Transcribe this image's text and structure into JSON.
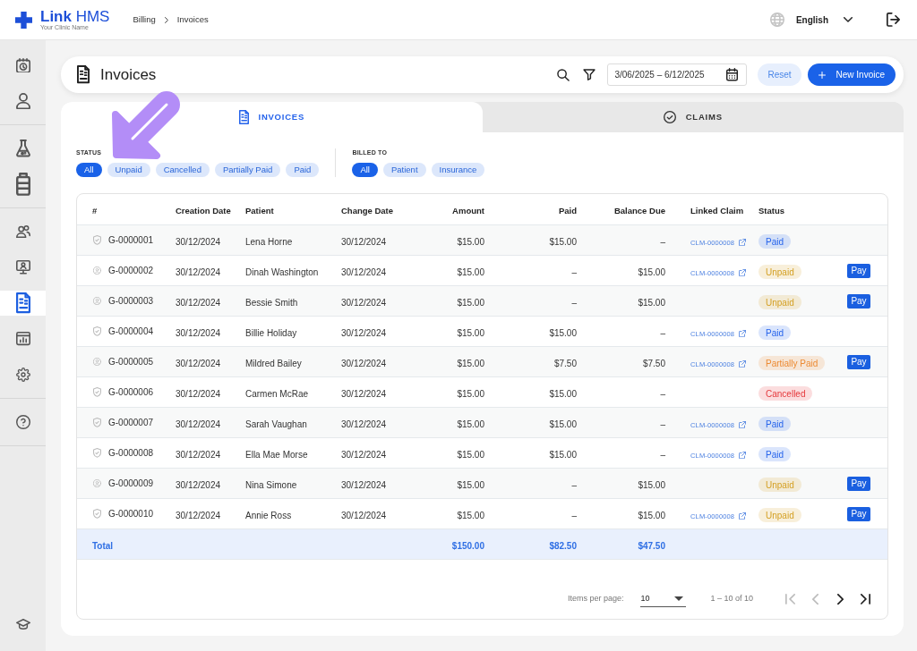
{
  "header": {
    "brand": "**Link** HMS",
    "subtitle": "Your Clinic Name",
    "breadcrumb": [
      "Billing",
      "Invoices"
    ],
    "language": "English"
  },
  "sidebar": {
    "groups": [
      {
        "items": [
          {
            "selected": false
          },
          {
            "selected": false
          }
        ]
      },
      {
        "items": [
          {
            "selected": false
          },
          {
            "selected": false
          }
        ]
      },
      {
        "items": [
          {
            "selected": false
          },
          {
            "selected": false
          },
          {
            "selected": true
          },
          {
            "selected": false
          },
          {
            "selected": false
          }
        ]
      },
      {
        "items": [
          {
            "selected": false
          }
        ]
      }
    ],
    "footer_items": [
      {
        "selected": false
      }
    ]
  },
  "page": {
    "title": "Invoices",
    "date_range": "3/06/2025 – 6/12/2025",
    "buttons": [
      {
        "kind": "secondary",
        "label": "Reset"
      },
      {
        "kind": "primary",
        "label": "New Invoice"
      }
    ]
  },
  "tabs": [
    {
      "label": "INVOICES",
      "selected": true
    },
    {
      "label": "CLAIMS",
      "selected": false
    }
  ],
  "filters": [
    {
      "label": "STATUS",
      "chips": [
        {
          "label": "All",
          "selected": true
        },
        {
          "label": "Unpaid",
          "selected": false
        },
        {
          "label": "Cancelled",
          "selected": false
        },
        {
          "label": "Partially Paid",
          "selected": false
        },
        {
          "label": "Paid",
          "selected": false
        }
      ]
    },
    {
      "label": "BILLED TO",
      "chips": [
        {
          "label": "All",
          "selected": true
        },
        {
          "label": "Patient",
          "selected": false
        },
        {
          "label": "Insurance",
          "selected": false
        }
      ]
    }
  ],
  "table": {
    "columns": [
      "#",
      "Creation Date",
      "Patient",
      "Change Date",
      "Amount",
      "Paid",
      "Balance Due",
      "Linked Claim",
      "Status"
    ],
    "rows": [
      {
        "kind": "insurance",
        "number": "G-0000001",
        "creation_date": "30/12/2024",
        "patient": "Lena Horne",
        "change_date": "30/12/2024",
        "amount": "$15.00",
        "paid": "$15.00",
        "balance_due": "–",
        "linked_claim": "CLM-0000008",
        "status": {
          "label": "Paid",
          "color": "#2563eb"
        }
      },
      {
        "kind": "patient",
        "number": "G-0000002",
        "creation_date": "30/12/2024",
        "patient": "Dinah Washington",
        "change_date": "30/12/2024",
        "amount": "$15.00",
        "paid": "–",
        "balance_due": "$15.00",
        "linked_claim": "CLM-0000008",
        "status": {
          "label": "Unpaid",
          "color": "#d4a024"
        },
        "action": "Pay"
      },
      {
        "kind": "patient",
        "number": "G-0000003",
        "creation_date": "30/12/2024",
        "patient": "Bessie Smith",
        "change_date": "30/12/2024",
        "amount": "$15.00",
        "paid": "–",
        "balance_due": "$15.00",
        "status": {
          "label": "Unpaid",
          "color": "#d4a024"
        },
        "action": "Pay"
      },
      {
        "kind": "insurance",
        "number": "G-0000004",
        "creation_date": "30/12/2024",
        "patient": "Billie Holiday",
        "change_date": "30/12/2024",
        "amount": "$15.00",
        "paid": "$15.00",
        "balance_due": "–",
        "linked_claim": "CLM-0000008",
        "status": {
          "label": "Paid",
          "color": "#2563eb"
        }
      },
      {
        "kind": "patient",
        "number": "G-0000005",
        "creation_date": "30/12/2024",
        "patient": "Mildred Bailey",
        "change_date": "30/12/2024",
        "amount": "$15.00",
        "paid": "$7.50",
        "balance_due": "$7.50",
        "linked_claim": "CLM-0000008",
        "status": {
          "label": "Partially Paid",
          "color": "#ec8a32"
        },
        "action": "Pay"
      },
      {
        "kind": "insurance",
        "number": "G-0000006",
        "creation_date": "30/12/2024",
        "patient": "Carmen McRae",
        "change_date": "30/12/2024",
        "amount": "$15.00",
        "paid": "$15.00",
        "balance_due": "–",
        "status": {
          "label": "Cancelled",
          "color": "#e5383b"
        }
      },
      {
        "kind": "insurance",
        "number": "G-0000007",
        "creation_date": "30/12/2024",
        "patient": "Sarah Vaughan",
        "change_date": "30/12/2024",
        "amount": "$15.00",
        "paid": "$15.00",
        "balance_due": "–",
        "linked_claim": "CLM-0000008",
        "status": {
          "label": "Paid",
          "color": "#2563eb"
        }
      },
      {
        "kind": "insurance",
        "number": "G-0000008",
        "creation_date": "30/12/2024",
        "patient": "Ella Mae Morse",
        "change_date": "30/12/2024",
        "amount": "$15.00",
        "paid": "$15.00",
        "balance_due": "–",
        "linked_claim": "CLM-0000008",
        "status": {
          "label": "Paid",
          "color": "#2563eb"
        }
      },
      {
        "kind": "patient",
        "number": "G-0000009",
        "creation_date": "30/12/2024",
        "patient": "Nina Simone",
        "change_date": "30/12/2024",
        "amount": "$15.00",
        "paid": "–",
        "balance_due": "$15.00",
        "status": {
          "label": "Unpaid",
          "color": "#d4a024"
        },
        "action": "Pay"
      },
      {
        "kind": "insurance",
        "number": "G-0000010",
        "creation_date": "30/12/2024",
        "patient": "Annie Ross",
        "change_date": "30/12/2024",
        "amount": "$15.00",
        "paid": "–",
        "balance_due": "$15.00",
        "linked_claim": "CLM-0000008",
        "status": {
          "label": "Unpaid",
          "color": "#d4a024"
        },
        "action": "Pay"
      }
    ],
    "total": {
      "label": "Total",
      "amount": "$150.00",
      "paid": "$82.50",
      "balance_due": "$47.50"
    }
  },
  "pagination": {
    "label": "Items per page:",
    "page_size": "10",
    "range": "1 – 10 of 10",
    "buttons": [
      {
        "kind": "first",
        "disabled": true
      },
      {
        "kind": "previous",
        "disabled": true
      },
      {
        "kind": "next",
        "disabled": false
      },
      {
        "kind": "last",
        "disabled": false
      }
    ]
  },
  "annotation": {
    "kind": "arrow"
  }
}
